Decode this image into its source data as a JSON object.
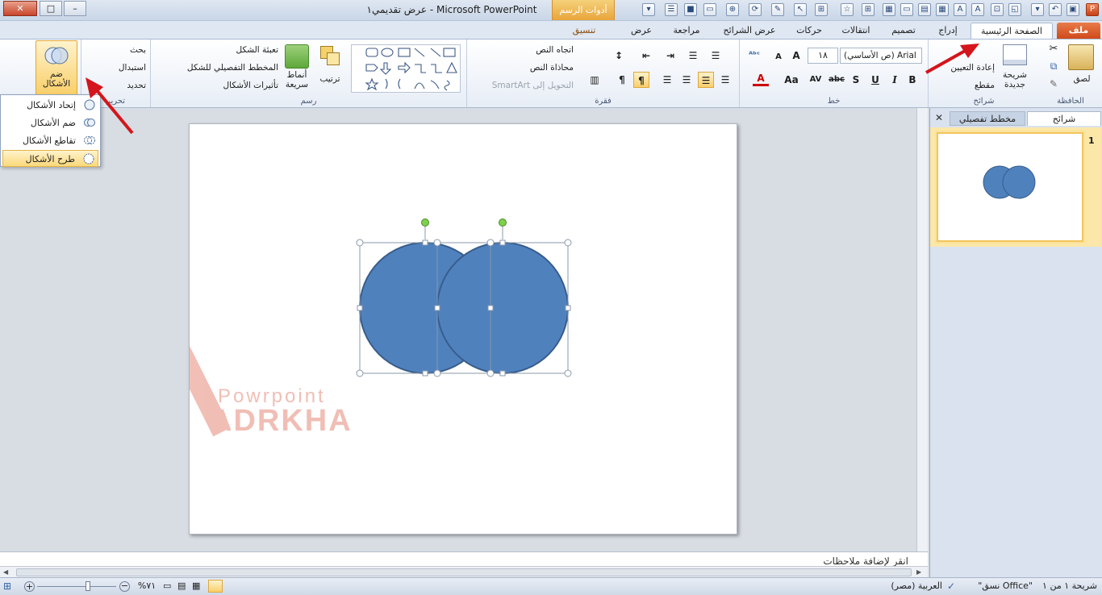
{
  "window": {
    "title": "عرض تقديمي١ - Microsoft PowerPoint",
    "contextual_tab": "أدوات الرسم",
    "contextual_subtab": "تنسيق",
    "minimize": "–",
    "maximize": "□",
    "close": "✕"
  },
  "tabs": {
    "file": "ملف",
    "home": "الصفحة الرئيسية",
    "insert": "إدراج",
    "design": "تصميم",
    "transitions": "انتقالات",
    "animations": "حركات",
    "slideshow": "عرض الشرائح",
    "review": "مراجعة",
    "view": "عرض",
    "format": "تنسيق"
  },
  "clipboard": {
    "label": "الحافظة",
    "paste": "لصق"
  },
  "slides": {
    "label": "شرائح",
    "new_slide": "شريحة جديدة",
    "reset": "إعادة التعيين",
    "section": "مقطع"
  },
  "font": {
    "label": "خط",
    "name": "(ص الأساسي) Arial",
    "size": "١٨",
    "bold": "B",
    "italic": "I",
    "underline": "U",
    "shadow": "S",
    "strike": "abc",
    "spacing": "AV",
    "case": "Aa",
    "grow": "A",
    "shrink": "A"
  },
  "paragraph": {
    "label": "فقرة",
    "text_direction": "اتجاه النص",
    "align_text": "محاذاة النص",
    "smartart": "التحويل إلى SmartArt"
  },
  "drawing": {
    "label": "رسم",
    "arrange": "ترتيب",
    "quick_styles_1": "أنماط",
    "quick_styles_2": "سريعة",
    "fill": "تعبئة الشكل",
    "outline": "المخطط التفصيلي للشكل",
    "effects": "تأثيرات الأشكال"
  },
  "editing": {
    "label": "تحرير",
    "find": "بحث",
    "replace": "استبدال",
    "select": "تحديد"
  },
  "combine": {
    "line1": "ضم",
    "line2": "الأشكال"
  },
  "menu": {
    "items": [
      "إتحاد الأشكال",
      "ضم الأشكال",
      "تقاطع الأشكال",
      "طرح الأشكال"
    ],
    "selected": 3
  },
  "pane": {
    "tab_slides": "شرائح",
    "tab_outline": "مخطط تفصيلي",
    "slide_number": "1",
    "close": "✕"
  },
  "notes": {
    "text": "انقر لإضافة ملاحظات"
  },
  "watermark": {
    "brand": "Powrpoint",
    "name": "ADRKHA"
  },
  "status": {
    "slide": "شريحة ١ من ١",
    "theme": "\"Office نسق\"",
    "language": "العربية (مصر)",
    "zoom": "٧١%"
  },
  "colors": {
    "shape": "#4f81bd",
    "shape_border": "#385d8a",
    "accent": "#d04a1a",
    "context": "#e8a53b"
  }
}
